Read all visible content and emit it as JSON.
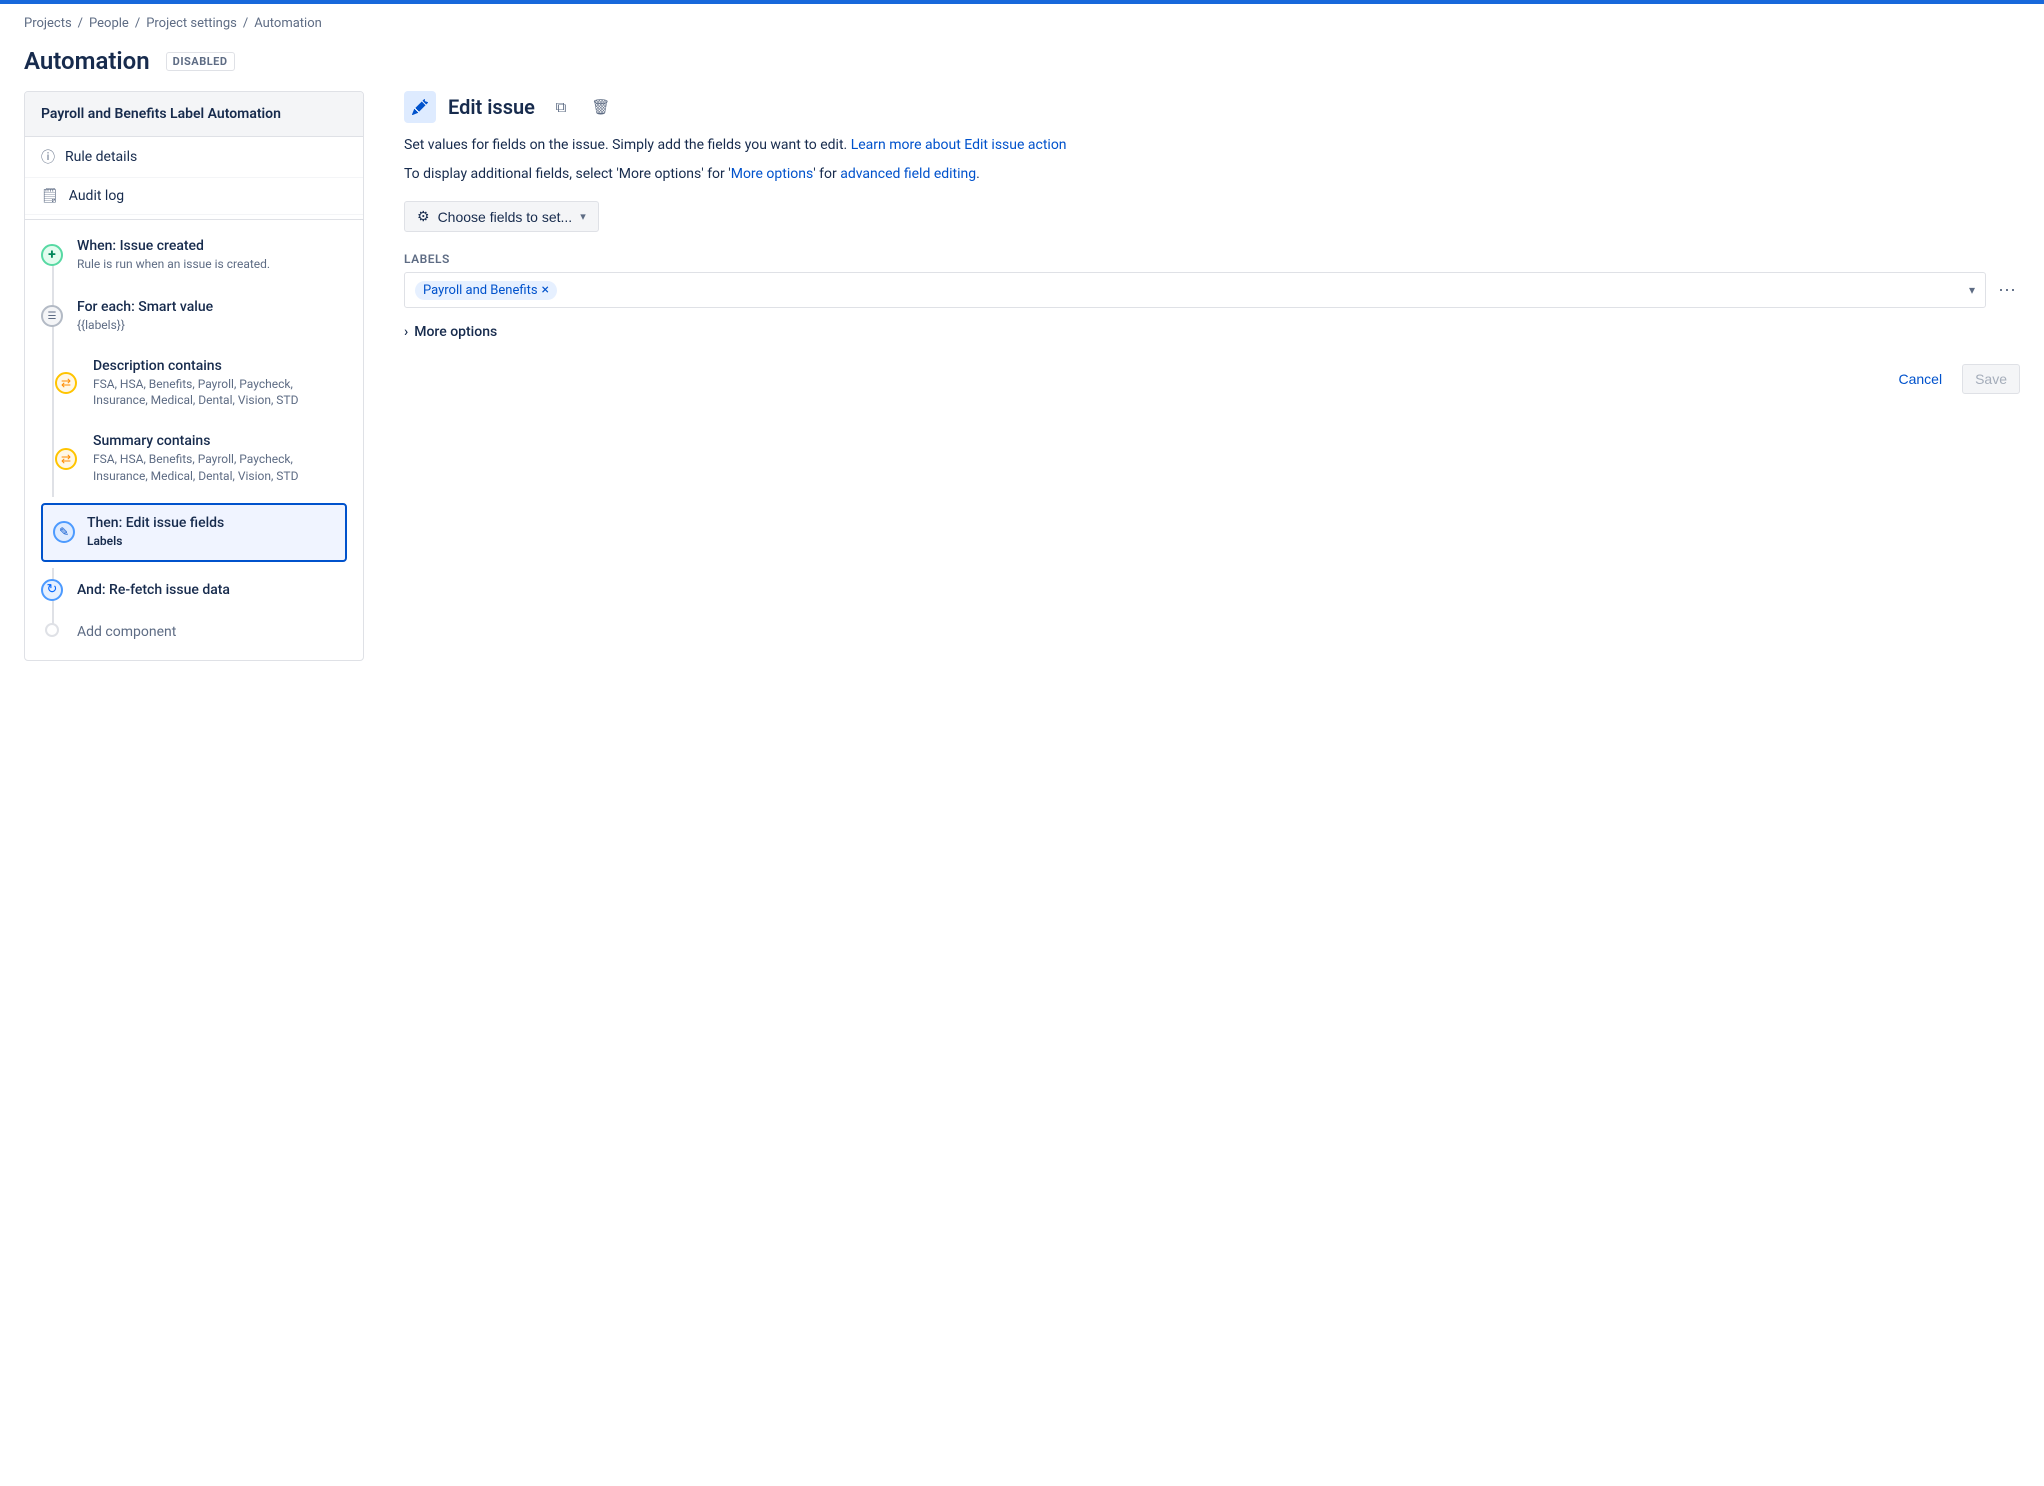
{
  "topbar": {
    "color": "#1868db"
  },
  "breadcrumb": {
    "items": [
      "Projects",
      "People",
      "Project settings",
      "Automation"
    ],
    "separators": [
      "/",
      "/",
      "/"
    ]
  },
  "page": {
    "title": "Automation",
    "status_badge": "DISABLED"
  },
  "left_panel": {
    "header": "Payroll and Benefits Label Automation",
    "nav_items": [
      {
        "label": "Rule details",
        "icon": "ℹ"
      },
      {
        "label": "Audit log",
        "icon": "📋"
      }
    ],
    "steps": [
      {
        "id": "when",
        "icon_type": "green",
        "icon": "+",
        "title": "When: Issue created",
        "subtitle": "Rule is run when an issue is created."
      },
      {
        "id": "for-each",
        "icon_type": "gray",
        "icon": "≡",
        "title": "For each: Smart value",
        "subtitle": "{{labels}}"
      },
      {
        "id": "desc-contains",
        "icon_type": "orange",
        "icon": "⇌",
        "title": "Description contains",
        "subtitle": "FSA, HSA, Benefits, Payroll, Paycheck, Insurance, Medical, Dental, Vision, STD"
      },
      {
        "id": "summary-contains",
        "icon_type": "orange",
        "icon": "⇌",
        "title": "Summary contains",
        "subtitle": "FSA, HSA, Benefits, Payroll, Paycheck, Insurance, Medical, Dental, Vision, STD"
      },
      {
        "id": "then-edit",
        "icon_type": "blue",
        "icon": "✎",
        "title": "Then: Edit issue fields",
        "subtitle": "Labels",
        "selected": true
      },
      {
        "id": "re-fetch",
        "icon_type": "light",
        "icon": "↻",
        "title": "And: Re-fetch issue data",
        "subtitle": ""
      },
      {
        "id": "add-component",
        "icon_type": "empty",
        "icon": "",
        "title": "Add component",
        "subtitle": ""
      }
    ]
  },
  "right_panel": {
    "title": "Edit issue",
    "description1": "Set values for fields on the issue. Simply add the fields you want to edit.",
    "learn_more_text": "Learn more about Edit issue action",
    "description2": "To display additional fields, select 'More options' for",
    "advanced_link": "advanced field editing",
    "choose_fields_btn": "Choose fields to set...",
    "labels_label": "Labels",
    "label_tag": "Payroll and Benefits",
    "more_options": "More options",
    "cancel_btn": "Cancel",
    "save_btn": "Save"
  }
}
